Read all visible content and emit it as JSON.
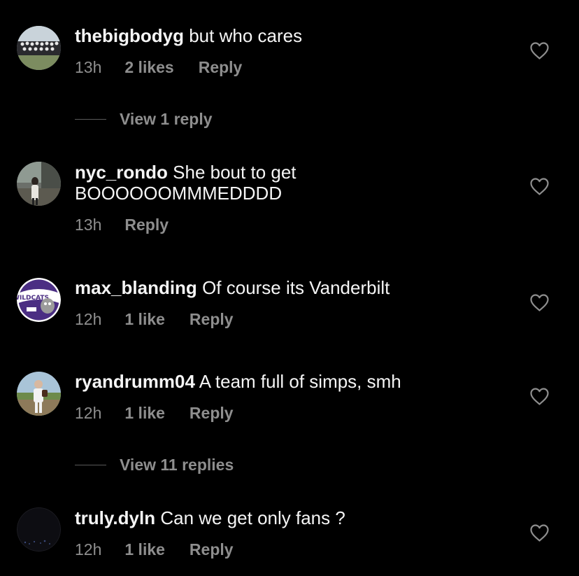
{
  "comments": [
    {
      "username": "thebigbodyg",
      "text": "but who cares",
      "time": "13h",
      "likes": "2 likes",
      "reply": "Reply",
      "view_replies": "View 1 reply"
    },
    {
      "username": "nyc_rondo",
      "text": "She bout to get BOOOOOOMMMEDDDD",
      "time": "13h",
      "likes": "",
      "reply": "Reply"
    },
    {
      "username": "max_blanding",
      "text": "Of course its Vanderbilt",
      "time": "12h",
      "likes": "1 like",
      "reply": "Reply"
    },
    {
      "username": "ryandrumm04",
      "text": "A team full of simps, smh",
      "time": "12h",
      "likes": "1 like",
      "reply": "Reply",
      "view_replies": "View 11 replies"
    },
    {
      "username": "truly.dyln",
      "text": "Can we get only fans ?",
      "time": "12h",
      "likes": "1 like",
      "reply": "Reply"
    }
  ],
  "avatar_badge_text": "WILDCATS",
  "icons": {
    "like": "heart-outline-icon"
  },
  "colors": {
    "background": "#000000",
    "primary_text": "#f5f5f5",
    "secondary_text": "#8e8e8e"
  }
}
